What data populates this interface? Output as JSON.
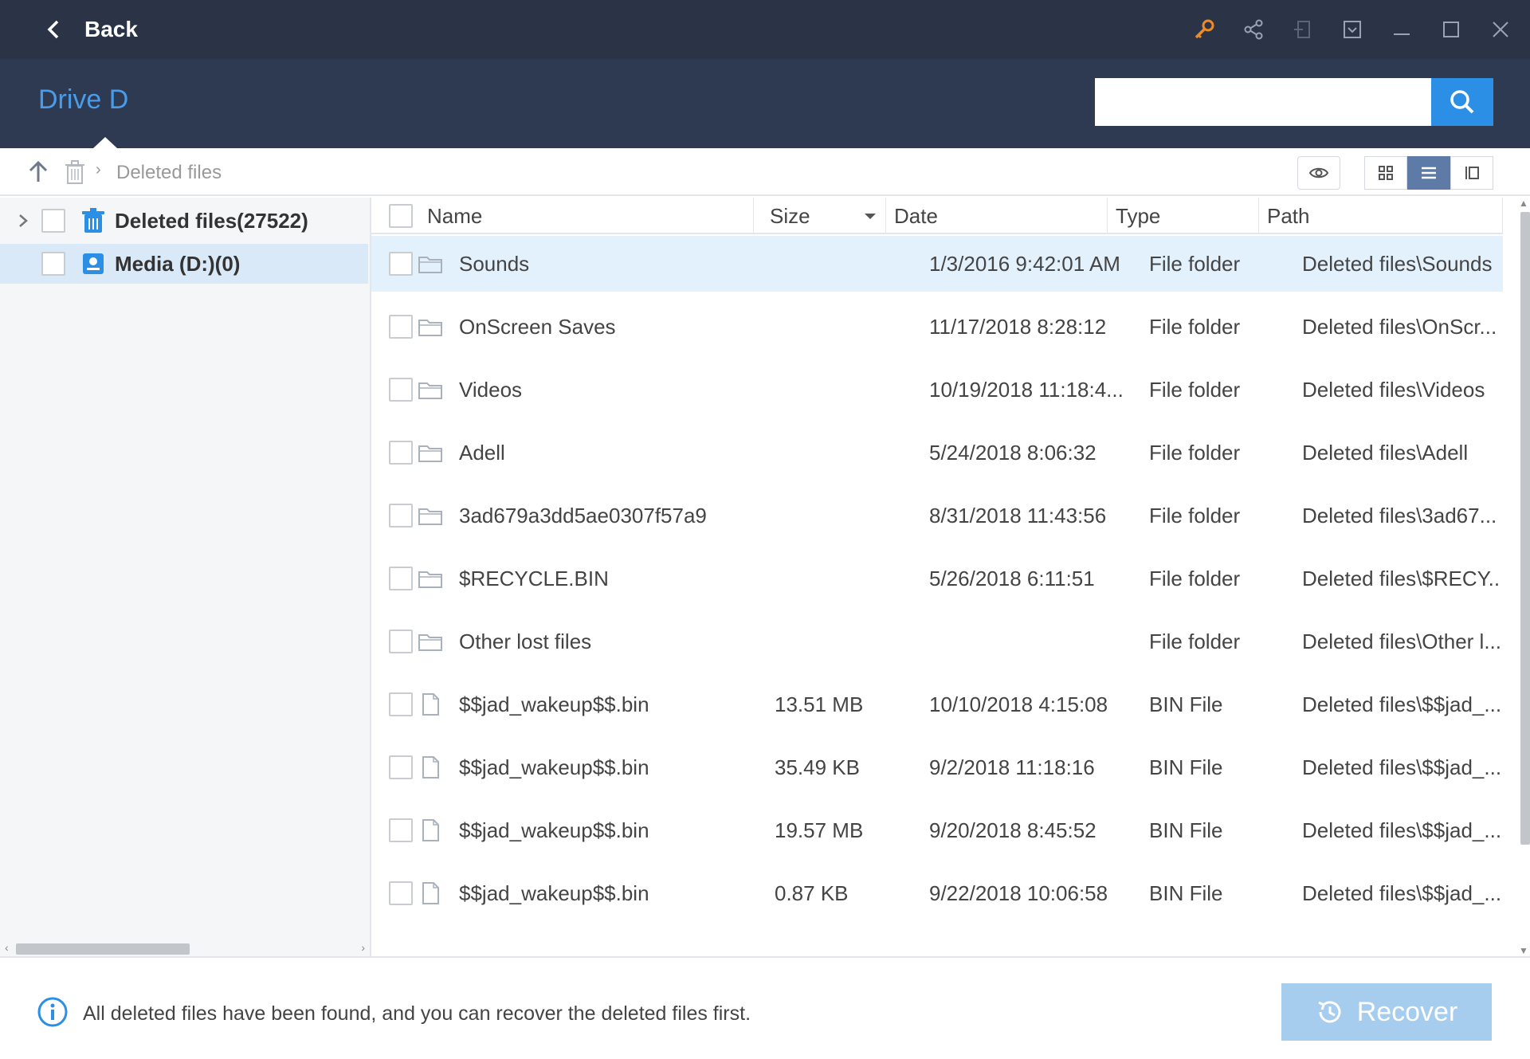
{
  "titlebar": {
    "back_label": "Back",
    "icons": [
      "key-icon",
      "share-icon",
      "exit-icon",
      "dropdown-icon",
      "minimize-icon",
      "maximize-icon",
      "close-icon"
    ],
    "key_color": "#f08a24"
  },
  "header": {
    "title": "Drive D",
    "search": {
      "value": "",
      "placeholder": ""
    }
  },
  "toolbar": {
    "breadcrumb": "Deleted files"
  },
  "tree": {
    "items": [
      {
        "label": "Deleted files(27522)",
        "icon": "trash-icon",
        "expandable": true,
        "selected": false
      },
      {
        "label": "Media (D:)(0)",
        "icon": "drive-icon",
        "expandable": false,
        "selected": true
      }
    ]
  },
  "table": {
    "columns": [
      "Name",
      "Size",
      "Date",
      "Type",
      "Path"
    ],
    "rows": [
      {
        "icon": "folder",
        "name": "Sounds",
        "size": "",
        "date": "1/3/2016 9:42:01 AM",
        "type": "File folder",
        "path": "Deleted files\\Sounds",
        "highlight": true
      },
      {
        "icon": "folder",
        "name": "OnScreen Saves",
        "size": "",
        "date": "11/17/2018 8:28:12",
        "type": "File folder",
        "path": "Deleted files\\OnScr..."
      },
      {
        "icon": "folder",
        "name": "Videos",
        "size": "",
        "date": "10/19/2018 11:18:4...",
        "type": "File folder",
        "path": "Deleted files\\Videos"
      },
      {
        "icon": "folder",
        "name": "Adell",
        "size": "",
        "date": "5/24/2018 8:06:32",
        "type": "File folder",
        "path": "Deleted files\\Adell"
      },
      {
        "icon": "folder",
        "name": "3ad679a3dd5ae0307f57a9",
        "size": "",
        "date": "8/31/2018 11:43:56",
        "type": "File folder",
        "path": "Deleted files\\3ad67..."
      },
      {
        "icon": "folder",
        "name": "$RECYCLE.BIN",
        "size": "",
        "date": "5/26/2018 6:11:51",
        "type": "File folder",
        "path": "Deleted files\\$RECY..."
      },
      {
        "icon": "folder",
        "name": "Other lost files",
        "size": "",
        "date": "",
        "type": "File folder",
        "path": "Deleted files\\Other l..."
      },
      {
        "icon": "file",
        "name": "$$jad_wakeup$$.bin",
        "size": "13.51 MB",
        "date": "10/10/2018 4:15:08",
        "type": "BIN File",
        "path": "Deleted files\\$$jad_..."
      },
      {
        "icon": "file",
        "name": "$$jad_wakeup$$.bin",
        "size": "35.49 KB",
        "date": "9/2/2018 11:18:16",
        "type": "BIN File",
        "path": "Deleted files\\$$jad_..."
      },
      {
        "icon": "file",
        "name": "$$jad_wakeup$$.bin",
        "size": "19.57 MB",
        "date": "9/20/2018 8:45:52",
        "type": "BIN File",
        "path": "Deleted files\\$$jad_..."
      },
      {
        "icon": "file",
        "name": "$$jad_wakeup$$.bin",
        "size": "0.87 KB",
        "date": "9/22/2018 10:06:58",
        "type": "BIN File",
        "path": "Deleted files\\$$jad_..."
      }
    ]
  },
  "footer": {
    "message": "All deleted files have been found, and you can recover the deleted files first.",
    "recover_label": "Recover"
  },
  "colors": {
    "titlebar": "#2b3446",
    "header": "#2e3a52",
    "accent": "#2b8fe6",
    "drive_title": "#4a9be8",
    "selected_row": "#e3f1fc",
    "recover_disabled": "#a6cdee"
  }
}
